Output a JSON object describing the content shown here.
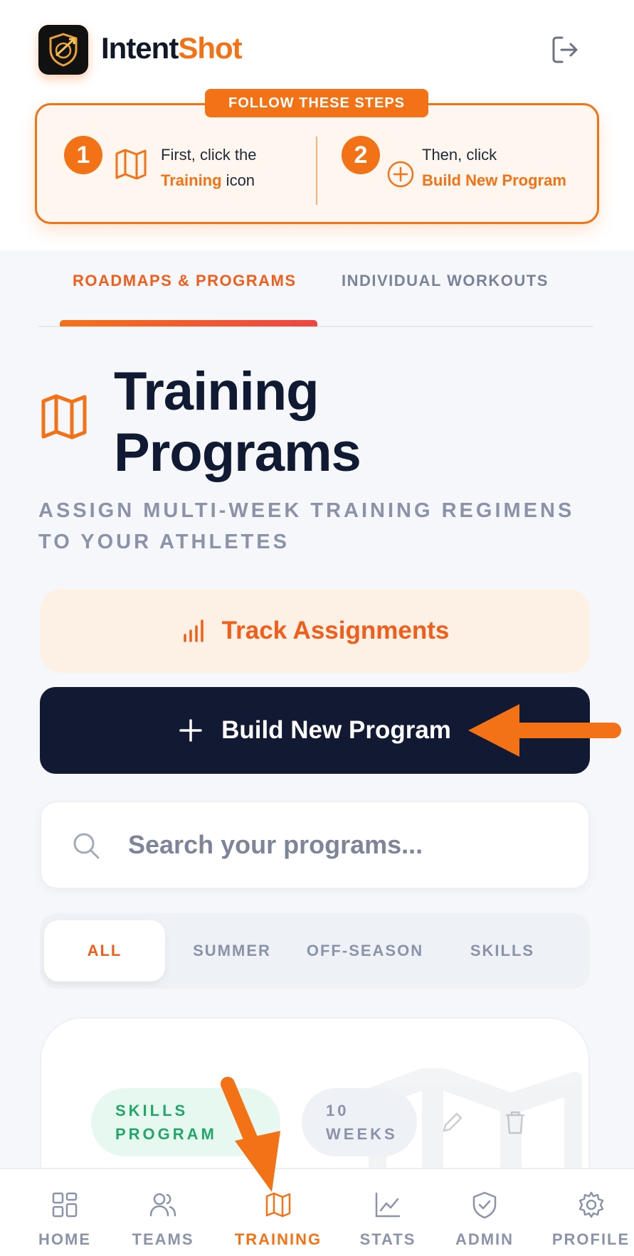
{
  "app": {
    "brand_part1": "Intent",
    "brand_part2": "Shot"
  },
  "steps": {
    "tag": "FOLLOW THESE STEPS",
    "step1": {
      "number": "1",
      "line1": "First, click the",
      "highlight": "Training",
      "line2_suffix": " icon"
    },
    "step2": {
      "number": "2",
      "line1": "Then, click",
      "highlight": "Build New Program"
    }
  },
  "tabs": [
    {
      "label": "ROADMAPS & PROGRAMS",
      "active": true
    },
    {
      "label": "INDIVIDUAL WORKOUTS",
      "active": false
    }
  ],
  "page": {
    "title_line1": "Training",
    "title_line2": "Programs",
    "subtitle": "ASSIGN MULTI-WEEK TRAINING REGIMENS TO YOUR ATHLETES"
  },
  "actions": {
    "track_label": "Track Assignments",
    "build_label": "Build New Program"
  },
  "search": {
    "placeholder": "Search your programs..."
  },
  "filters": [
    {
      "label": "ALL",
      "active": true
    },
    {
      "label": "SUMMER",
      "active": false
    },
    {
      "label": "OFF-SEASON",
      "active": false
    },
    {
      "label": "SKILLS",
      "active": false
    }
  ],
  "program_card": {
    "category_line1": "SKILLS",
    "category_line2": "PROGRAM",
    "duration_line1": "10",
    "duration_line2": "WEEKS"
  },
  "bottom_nav": [
    {
      "label": "HOME",
      "icon": "grid-icon",
      "active": false
    },
    {
      "label": "TEAMS",
      "icon": "users-icon",
      "active": false
    },
    {
      "label": "TRAINING",
      "icon": "map-icon",
      "active": true
    },
    {
      "label": "STATS",
      "icon": "chart-icon",
      "active": false
    },
    {
      "label": "ADMIN",
      "icon": "shield-icon",
      "active": false
    },
    {
      "label": "PROFILE",
      "icon": "gear-icon",
      "active": false
    }
  ],
  "colors": {
    "accent": "#f47216",
    "navy": "#121a33",
    "muted": "#8a93a7",
    "success": "#22a66a"
  }
}
